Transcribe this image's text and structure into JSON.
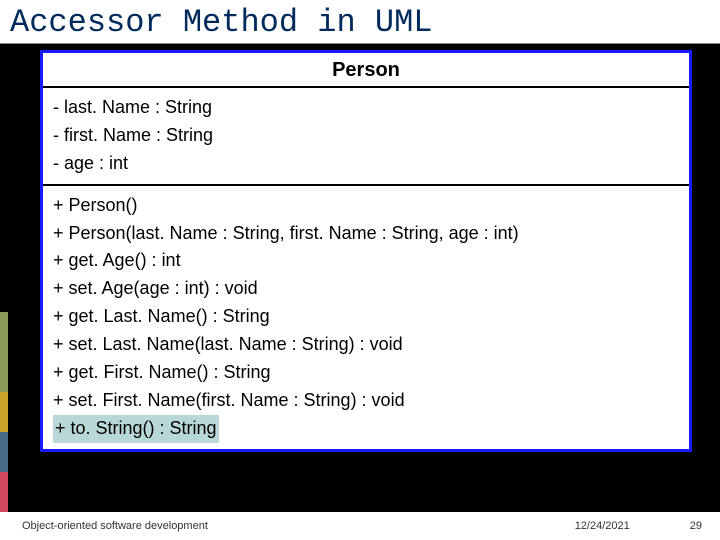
{
  "title": "Accessor Method in UML",
  "uml": {
    "className": "Person",
    "attributes": [
      "- last. Name : String",
      "- first. Name : String",
      "- age : int"
    ],
    "operations": [
      "+ Person()",
      "+ Person(last. Name : String, first. Name : String, age : int)",
      "+ get. Age() : int",
      "+ set. Age(age : int) : void",
      "+ get. Last. Name() : String",
      "+ set. Last. Name(last. Name : String) : void",
      "+ get. First. Name() : String",
      "+ set. First. Name(first. Name : String) : void"
    ],
    "highlighted_op": "+ to. String() : String"
  },
  "footer": {
    "left": "Object-oriented software development",
    "date": "12/24/2021",
    "page": "29"
  }
}
